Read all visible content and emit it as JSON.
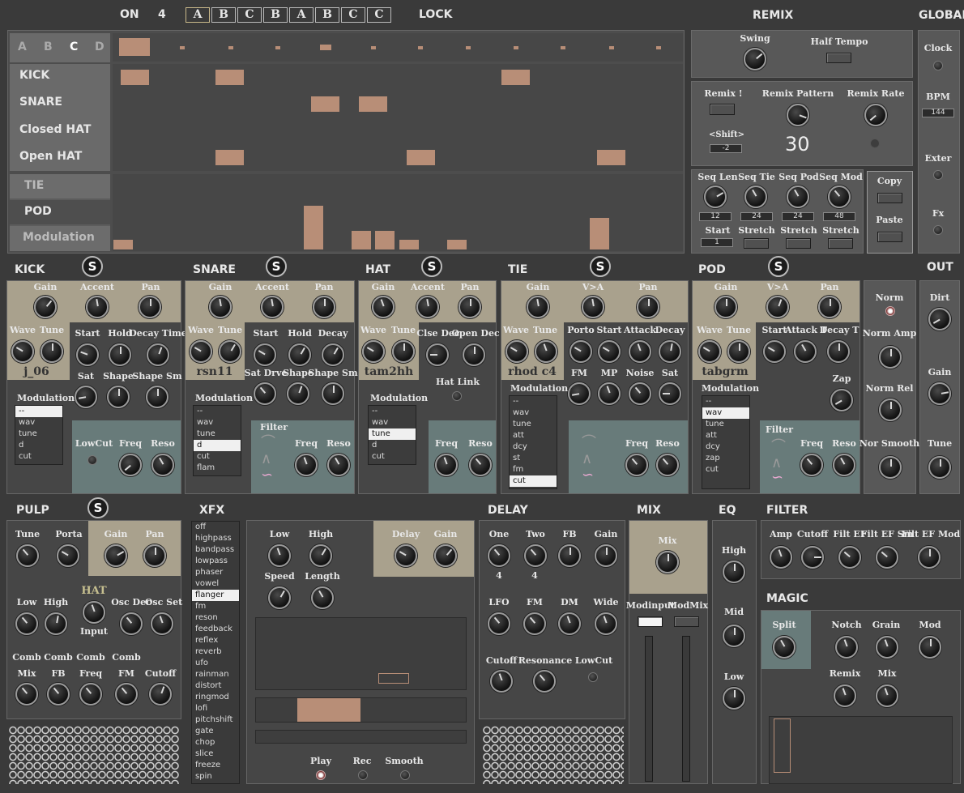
{
  "top": {
    "on": "ON",
    "count": "4",
    "patterns": [
      "A",
      "B",
      "C",
      "B",
      "A",
      "B",
      "C",
      "C"
    ],
    "lock": "LOCK",
    "remix": "REMIX",
    "global": "GLOBAL"
  },
  "seq": {
    "tabs": [
      "A",
      "B",
      "C",
      "D"
    ],
    "rows": [
      "KICK",
      "SNARE",
      "Closed HAT",
      "Open HAT"
    ],
    "mod_rows": [
      "TIE",
      "POD",
      "Modulation"
    ]
  },
  "remix": {
    "swing": "Swing",
    "half_tempo": "Half Tempo",
    "remix_btn": "Remix !",
    "remix_pattern": "Remix Pattern",
    "remix_rate": "Remix Rate",
    "shift": "<Shift>",
    "shift_val": "-2",
    "pattern_num": "30",
    "seq_len": "Seq Len",
    "seq_tie": "Seq Tie",
    "seq_pod": "Seq Pod",
    "seq_mod": "Seq Mod",
    "seq_len_val": "12",
    "seq_tie_val": "24",
    "seq_pod_val": "24",
    "seq_mod_val": "48",
    "start": "Start",
    "start_val": "1",
    "stretch": "Stretch",
    "copy": "Copy",
    "paste": "Paste"
  },
  "global": {
    "clock": "Clock",
    "bpm": "BPM",
    "bpm_val": "144",
    "exter": "Exter",
    "fx": "Fx"
  },
  "kick": {
    "title": "KICK",
    "s": "S",
    "gain": "Gain",
    "accent": "Accent",
    "pan": "Pan",
    "wave": "Wave",
    "tune": "Tune",
    "sample": "j_06",
    "start": "Start",
    "hold": "Hold",
    "decay_time": "Decay Time",
    "sat": "Sat",
    "shape": "Shape",
    "shape_sm": "Shape Sm",
    "modulation": "Modulation",
    "mod_items": [
      "--",
      "wav",
      "tune",
      "d",
      "cut"
    ],
    "mod_sel": 0,
    "lowcut": "LowCut",
    "freq": "Freq",
    "reso": "Reso"
  },
  "snare": {
    "title": "SNARE",
    "s": "S",
    "gain": "Gain",
    "accent": "Accent",
    "pan": "Pan",
    "wave": "Wave",
    "tune": "Tune",
    "sample": "rsn11",
    "start": "Start",
    "hold": "Hold",
    "decay": "Decay",
    "sat_drve": "Sat Drve",
    "shape": "Shape",
    "shape_sm": "Shape Sm",
    "modulation": "Modulation",
    "mod_items": [
      "--",
      "wav",
      "tune",
      "d",
      "cut",
      "flam"
    ],
    "mod_sel": 3,
    "filter": "Filter",
    "freq": "Freq",
    "reso": "Reso"
  },
  "hat": {
    "title": "HAT",
    "s": "S",
    "gain": "Gain",
    "accent": "Accent",
    "pan": "Pan",
    "wave": "Wave",
    "tune": "Tune",
    "sample": "tam2hh",
    "clse_dec": "Clse Dec",
    "open_dec": "Open Dec",
    "hat_link": "Hat Link",
    "modulation": "Modulation",
    "mod_items": [
      "--",
      "wav",
      "tune",
      "d",
      "cut"
    ],
    "mod_sel": 2,
    "freq": "Freq",
    "reso": "Reso"
  },
  "tie": {
    "title": "TIE",
    "s": "S",
    "gain": "Gain",
    "va": "V>A",
    "pan": "Pan",
    "wave": "Wave",
    "tune": "Tune",
    "sample": "rhod c4",
    "porto": "Porto",
    "start": "Start",
    "attack": "Attack",
    "decay": "Decay",
    "fm": "FM",
    "mp": "MP",
    "noise": "Noise",
    "sat": "Sat",
    "modulation": "Modulation",
    "mod_items": [
      "--",
      "wav",
      "tune",
      "att",
      "dcy",
      "st",
      "fm",
      "cut"
    ],
    "mod_sel": 7,
    "freq": "Freq",
    "reso": "Reso"
  },
  "pod": {
    "title": "POD",
    "s": "S",
    "gain": "Gain",
    "va": "V>A",
    "pan": "Pan",
    "wave": "Wave",
    "tune": "Tune",
    "sample": "tabgrm",
    "start": "Start",
    "attack_t": "Attack T",
    "decay_t": "Decay T",
    "zap": "Zap",
    "modulation": "Modulation",
    "mod_items": [
      "--",
      "wav",
      "tune",
      "att",
      "dcy",
      "zap",
      "cut"
    ],
    "mod_sel": 1,
    "filter": "Filter",
    "freq": "Freq",
    "reso": "Reso"
  },
  "out": {
    "title": "OUT",
    "norm": "Norm",
    "norm_amp": "Norm Amp",
    "norm_rel": "Norm Rel",
    "nor_smooth": "Nor Smooth",
    "dirt": "Dirt",
    "gain": "Gain",
    "tune": "Tune"
  },
  "pulp": {
    "title": "PULP",
    "s": "S",
    "tune": "Tune",
    "porta": "Porta",
    "gain": "Gain",
    "pan": "Pan",
    "low": "Low",
    "high": "High",
    "hat": "HAT",
    "input": "Input",
    "osc_dec": "Osc Dec",
    "osc_set": "Osc Set",
    "comb": "Comb",
    "mix": "Mix",
    "fb": "FB",
    "freq": "Freq",
    "fm": "FM",
    "cutoff": "Cutoff"
  },
  "xfx": {
    "title": "XFX",
    "items": [
      "off",
      "highpass",
      "bandpass",
      "lowpass",
      "phaser",
      "vowel",
      "flanger",
      "fm",
      "reson",
      "feedback",
      "reflex",
      "reverb",
      "ufo",
      "rainman",
      "distort",
      "ringmod",
      "lofi",
      "pitchshift",
      "gate",
      "chop",
      "slice",
      "freeze",
      "spin"
    ],
    "sel": 6,
    "low": "Low",
    "high": "High",
    "speed": "Speed",
    "length": "Length",
    "delay": "Delay",
    "gain": "Gain",
    "play": "Play",
    "rec": "Rec",
    "smooth": "Smooth"
  },
  "delay": {
    "title": "DELAY",
    "one": "One",
    "two": "Two",
    "fb": "FB",
    "gain": "Gain",
    "one_val": "4",
    "two_val": "4",
    "lfo": "LFO",
    "fm": "FM",
    "dm": "DM",
    "wide": "Wide",
    "cutoff": "Cutoff",
    "resonance": "Resonance",
    "lowcut": "LowCut"
  },
  "mix": {
    "title": "MIX",
    "mix": "Mix",
    "modinput": "Modinput",
    "modmix": "ModMix"
  },
  "eq": {
    "title": "EQ",
    "high": "High",
    "mid": "Mid",
    "low": "Low"
  },
  "filter": {
    "title": "FILTER",
    "amp": "Amp",
    "cutoff": "Cutoff",
    "filt_ef": "Filt EF",
    "filt_ef_sm": "Filt EF Sm",
    "filt_ef_mod": "Filt EF Mod"
  },
  "magic": {
    "title": "MAGIC",
    "split": "Split",
    "notch": "Notch",
    "grain": "Grain",
    "mod": "Mod",
    "remix": "Remix",
    "mix": "Mix"
  }
}
